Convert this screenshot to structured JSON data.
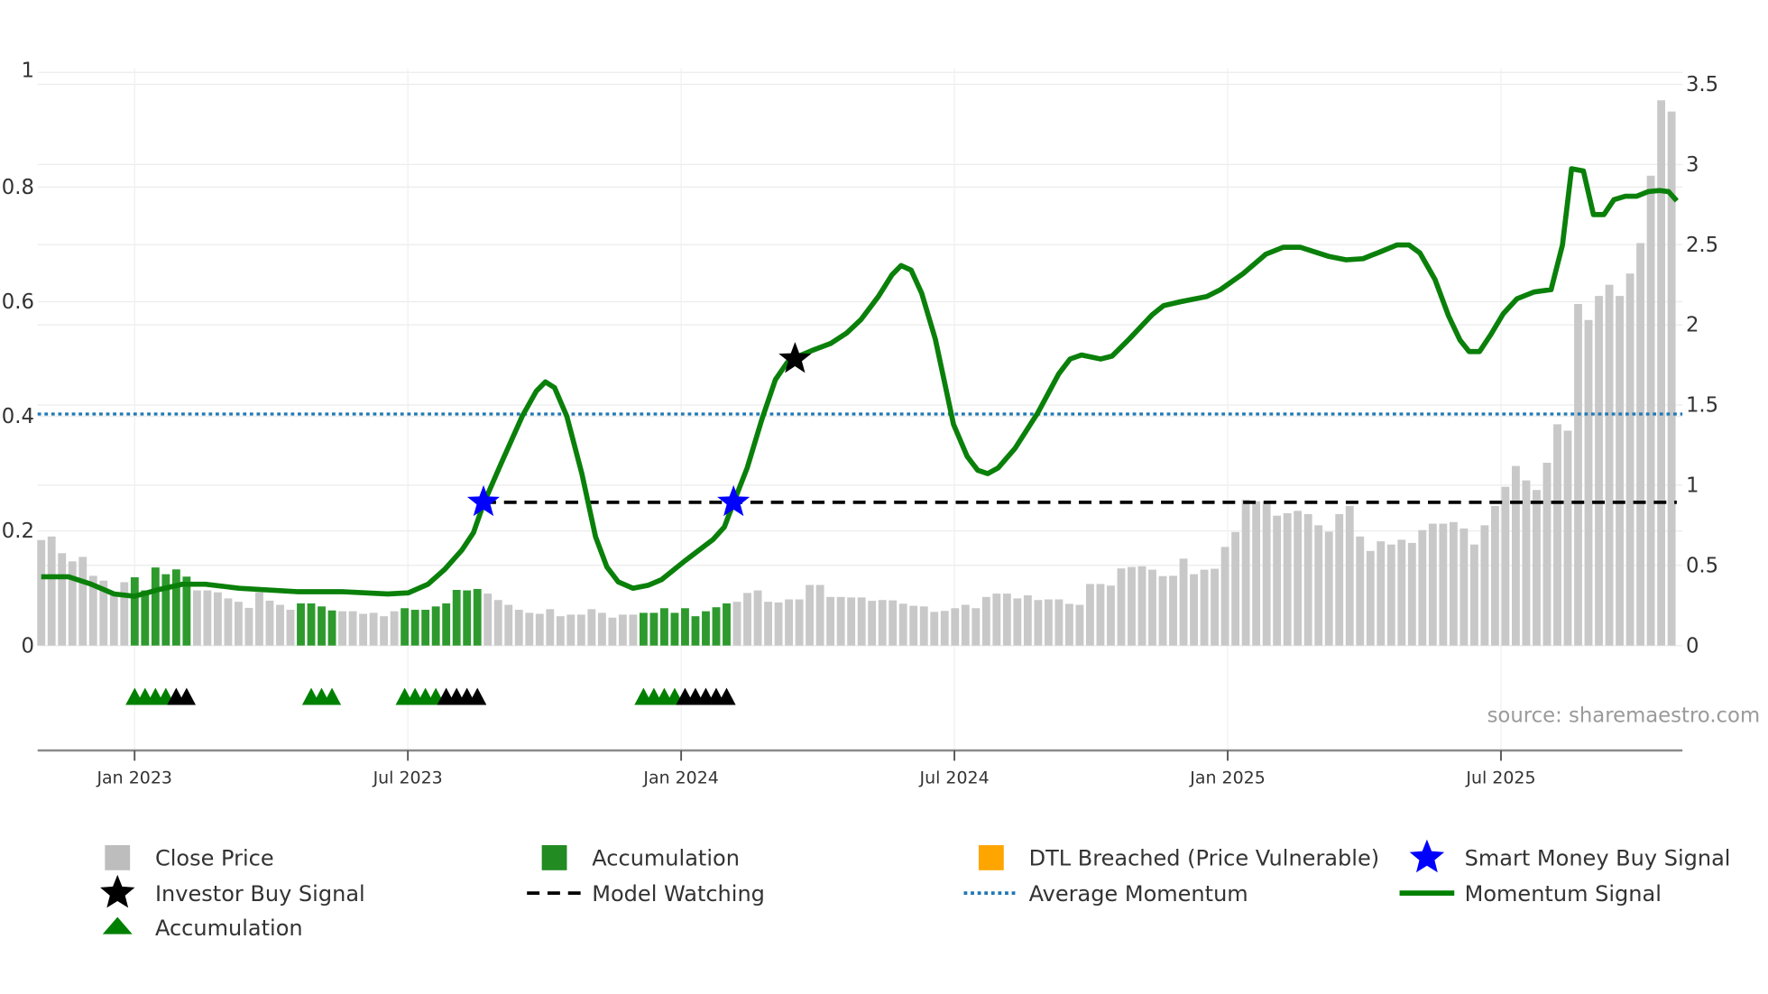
{
  "chart_data": {
    "type": "bar+line",
    "x_unit": "months since Jan 2023",
    "x_ticks": [
      {
        "month": 0,
        "label": "Jan 2023"
      },
      {
        "month": 6,
        "label": "Jul 2023"
      },
      {
        "month": 12,
        "label": "Jan 2024"
      },
      {
        "month": 18,
        "label": "Jul 2024"
      },
      {
        "month": 24,
        "label": "Jan 2025"
      },
      {
        "month": 30,
        "label": "Jul 2025"
      }
    ],
    "left_axis": {
      "range": [
        0,
        1
      ],
      "ticks": [
        {
          "v": 0,
          "label": "0"
        },
        {
          "v": 0.2,
          "label": "0.2"
        },
        {
          "v": 0.4,
          "label": "0.4"
        },
        {
          "v": 0.6,
          "label": "0.6"
        },
        {
          "v": 0.8,
          "label": "0.8"
        },
        {
          "v": 1,
          "label": "1"
        }
      ]
    },
    "right_axis": {
      "range": [
        0,
        3.5
      ],
      "ticks": [
        {
          "v": 0,
          "label": "0"
        },
        {
          "v": 0.5,
          "label": "0.5"
        },
        {
          "v": 1,
          "label": "1"
        },
        {
          "v": 1.5,
          "label": "1.5"
        },
        {
          "v": 2,
          "label": "2"
        },
        {
          "v": 2.5,
          "label": "2.5"
        },
        {
          "v": 3,
          "label": "3"
        },
        {
          "v": 3.5,
          "label": "3.5"
        }
      ]
    },
    "close_price": {
      "axis": "right",
      "first_month": -2.05,
      "step_months": 0.228,
      "values": [
        0.658,
        0.68,
        0.576,
        0.525,
        0.553,
        0.435,
        0.405,
        0.334,
        0.395,
        0.426,
        0.344,
        0.487,
        0.445,
        0.475,
        0.43,
        0.344,
        0.344,
        0.332,
        0.294,
        0.273,
        0.235,
        0.332,
        0.28,
        0.254,
        0.223,
        0.263,
        0.263,
        0.244,
        0.219,
        0.214,
        0.214,
        0.198,
        0.204,
        0.183,
        0.214,
        0.233,
        0.223,
        0.223,
        0.244,
        0.263,
        0.347,
        0.344,
        0.353,
        0.324,
        0.284,
        0.254,
        0.223,
        0.204,
        0.198,
        0.227,
        0.183,
        0.193,
        0.193,
        0.227,
        0.204,
        0.174,
        0.193,
        0.193,
        0.204,
        0.204,
        0.233,
        0.204,
        0.233,
        0.183,
        0.214,
        0.239,
        0.263,
        0.273,
        0.328,
        0.344,
        0.273,
        0.269,
        0.288,
        0.288,
        0.378,
        0.378,
        0.303,
        0.303,
        0.3,
        0.3,
        0.279,
        0.284,
        0.282,
        0.261,
        0.248,
        0.244,
        0.21,
        0.216,
        0.233,
        0.254,
        0.233,
        0.303,
        0.324,
        0.324,
        0.294,
        0.313,
        0.284,
        0.288,
        0.288,
        0.26,
        0.254,
        0.384,
        0.384,
        0.374,
        0.481,
        0.49,
        0.494,
        0.473,
        0.433,
        0.435,
        0.542,
        0.445,
        0.473,
        0.479,
        0.615,
        0.708,
        0.91,
        0.9,
        0.9,
        0.81,
        0.825,
        0.84,
        0.82,
        0.75,
        0.71,
        0.82,
        0.87,
        0.68,
        0.59,
        0.65,
        0.63,
        0.66,
        0.64,
        0.72,
        0.76,
        0.76,
        0.77,
        0.73,
        0.63,
        0.75,
        0.87,
        0.99,
        1.12,
        1.03,
        0.97,
        1.14,
        1.38,
        1.34,
        2.13,
        2.03,
        2.18,
        2.25,
        2.18,
        2.32,
        2.51,
        2.93,
        3.4,
        3.33
      ],
      "accumulation_bar_ranges": [
        [
          10,
          15
        ],
        [
          26,
          29
        ],
        [
          36,
          43
        ],
        [
          59,
          67
        ]
      ]
    },
    "momentum_signal": {
      "axis": "left",
      "points": [
        [
          -2.05,
          0.12
        ],
        [
          -1.45,
          0.12
        ],
        [
          -0.95,
          0.107
        ],
        [
          -0.45,
          0.09
        ],
        [
          0,
          0.086
        ],
        [
          0.55,
          0.098
        ],
        [
          1.05,
          0.107
        ],
        [
          1.55,
          0.107
        ],
        [
          2.3,
          0.1
        ],
        [
          3.56,
          0.094
        ],
        [
          4.56,
          0.094
        ],
        [
          5.56,
          0.09
        ],
        [
          6.01,
          0.092
        ],
        [
          6.44,
          0.107
        ],
        [
          6.81,
          0.133
        ],
        [
          7.19,
          0.167
        ],
        [
          7.44,
          0.197
        ],
        [
          7.66,
          0.247
        ],
        [
          8.06,
          0.32
        ],
        [
          8.51,
          0.4
        ],
        [
          8.82,
          0.444
        ],
        [
          9.02,
          0.46
        ],
        [
          9.22,
          0.45
        ],
        [
          9.49,
          0.4
        ],
        [
          9.82,
          0.3
        ],
        [
          10.12,
          0.19
        ],
        [
          10.37,
          0.137
        ],
        [
          10.62,
          0.111
        ],
        [
          10.94,
          0.1
        ],
        [
          11.27,
          0.105
        ],
        [
          11.57,
          0.115
        ],
        [
          12.07,
          0.147
        ],
        [
          12.7,
          0.185
        ],
        [
          12.95,
          0.207
        ],
        [
          13.15,
          0.249
        ],
        [
          13.45,
          0.31
        ],
        [
          13.77,
          0.394
        ],
        [
          14.07,
          0.464
        ],
        [
          14.33,
          0.494
        ],
        [
          14.58,
          0.505
        ],
        [
          14.88,
          0.515
        ],
        [
          15.28,
          0.527
        ],
        [
          15.63,
          0.545
        ],
        [
          15.95,
          0.569
        ],
        [
          16.33,
          0.609
        ],
        [
          16.63,
          0.647
        ],
        [
          16.83,
          0.663
        ],
        [
          17.05,
          0.655
        ],
        [
          17.28,
          0.615
        ],
        [
          17.58,
          0.535
        ],
        [
          17.98,
          0.386
        ],
        [
          18.28,
          0.33
        ],
        [
          18.51,
          0.306
        ],
        [
          18.73,
          0.3
        ],
        [
          18.96,
          0.31
        ],
        [
          19.33,
          0.344
        ],
        [
          19.83,
          0.406
        ],
        [
          20.29,
          0.474
        ],
        [
          20.54,
          0.5
        ],
        [
          20.79,
          0.507
        ],
        [
          21.21,
          0.5
        ],
        [
          21.46,
          0.505
        ],
        [
          21.84,
          0.535
        ],
        [
          22.34,
          0.577
        ],
        [
          22.59,
          0.593
        ],
        [
          22.97,
          0.6
        ],
        [
          23.54,
          0.609
        ],
        [
          23.84,
          0.621
        ],
        [
          24.34,
          0.649
        ],
        [
          24.84,
          0.683
        ],
        [
          25.22,
          0.695
        ],
        [
          25.59,
          0.695
        ],
        [
          26.22,
          0.679
        ],
        [
          26.6,
          0.673
        ],
        [
          26.97,
          0.675
        ],
        [
          27.35,
          0.687
        ],
        [
          27.72,
          0.699
        ],
        [
          27.98,
          0.699
        ],
        [
          28.22,
          0.685
        ],
        [
          28.55,
          0.639
        ],
        [
          28.85,
          0.575
        ],
        [
          29.1,
          0.533
        ],
        [
          29.3,
          0.513
        ],
        [
          29.53,
          0.513
        ],
        [
          29.78,
          0.543
        ],
        [
          30.05,
          0.579
        ],
        [
          30.35,
          0.605
        ],
        [
          30.73,
          0.617
        ],
        [
          31.1,
          0.621
        ],
        [
          31.35,
          0.699
        ],
        [
          31.55,
          0.832
        ],
        [
          31.81,
          0.828
        ],
        [
          32.03,
          0.752
        ],
        [
          32.26,
          0.752
        ],
        [
          32.48,
          0.778
        ],
        [
          32.73,
          0.784
        ],
        [
          32.98,
          0.784
        ],
        [
          33.23,
          0.792
        ],
        [
          33.48,
          0.794
        ],
        [
          33.68,
          0.792
        ],
        [
          33.86,
          0.776
        ]
      ]
    },
    "average_momentum": 0.404,
    "model_watching": {
      "value": 0.25,
      "from_month": 7.66,
      "to_month": 33.86
    },
    "smart_money_buy_signals": [
      [
        7.66,
        0.25
      ],
      [
        13.15,
        0.25
      ]
    ],
    "investor_buy_signals": [
      [
        14.5,
        0.5
      ]
    ],
    "accumulation_markers": [
      10,
      11,
      12,
      13,
      27,
      28,
      29,
      36,
      37,
      38,
      39,
      59,
      60,
      61,
      62
    ],
    "investor_markers": [
      14,
      15,
      40,
      41,
      42,
      43,
      63,
      64,
      65,
      66,
      67
    ],
    "legend_placement": "bottom",
    "annotation": "source: sharemaestro.com",
    "grid": true
  },
  "legend": [
    {
      "label": "Close Price",
      "icon": "gray-square",
      "color": "#bdbdbd"
    },
    {
      "label": "Accumulation",
      "icon": "green-square",
      "color": "#228b22"
    },
    {
      "label": "DTL Breached (Price Vulnerable)",
      "icon": "orange-square",
      "color": "#ffa500"
    },
    {
      "label": "Smart Money Buy Signal",
      "icon": "blue-star",
      "color": "#0000ff"
    },
    {
      "label": "Investor Buy Signal",
      "icon": "black-star",
      "color": "#000000"
    },
    {
      "label": "Model Watching",
      "icon": "black-dashed-line",
      "color": "#000000"
    },
    {
      "label": "Average Momentum",
      "icon": "blue-dotted-line",
      "color": "#1f77b4"
    },
    {
      "label": "Momentum Signal",
      "icon": "green-line",
      "color": "#008000"
    },
    {
      "label": "Accumulation",
      "icon": "green-triangle",
      "color": "#008000"
    }
  ],
  "colors": {
    "bar": "#c8c8c8",
    "bar_accum": "#2e9a2e",
    "momentum": "#0a800a",
    "avg": "#1f77b4",
    "watch": "#000000",
    "smart": "#0000ff"
  }
}
